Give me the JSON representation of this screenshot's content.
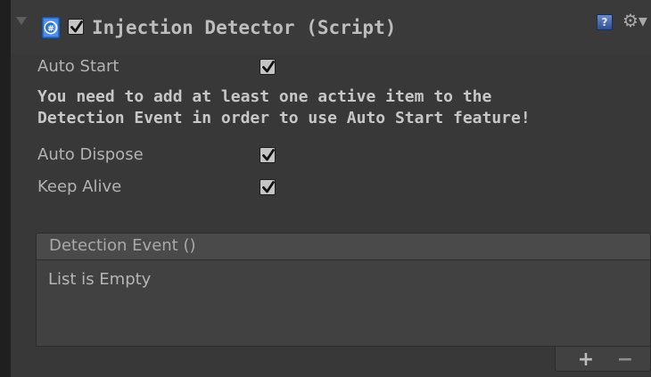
{
  "component": {
    "title": "Injection Detector (Script)",
    "enabled": true
  },
  "fields": [
    {
      "label": "Auto Start",
      "checked": true
    },
    {
      "label": "Auto Dispose",
      "checked": true
    },
    {
      "label": "Keep Alive",
      "checked": true
    }
  ],
  "warning": {
    "line1": "You need to add at least one active item to the",
    "line2": "Detection Event in order to use Auto Start feature!"
  },
  "event_list": {
    "title": "Detection Event ()",
    "empty_text": "List is Empty",
    "add_label": "+",
    "remove_label": "−"
  },
  "icons": {
    "fold": "foldout-arrow-icon",
    "script": "csharp-script-icon",
    "help": "help-icon",
    "gear": "gear-icon",
    "check": "checkmark-icon"
  },
  "colors": {
    "background": "#383838",
    "header_background": "#3a3a3a",
    "text": "#b3b3b3",
    "script_icon_blue": "#2c6fc9"
  }
}
